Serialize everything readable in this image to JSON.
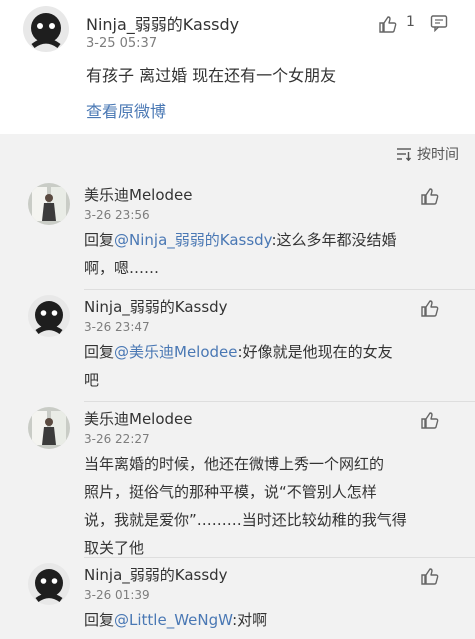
{
  "post": {
    "user": "Ninja_弱弱的Kassdy",
    "time": "3-25 05:37",
    "like_count": "1",
    "content": "有孩子 离过婚 现在还有一个女朋友",
    "view_original": "查看原微博"
  },
  "sort": {
    "label": "按时间"
  },
  "comments": [
    {
      "user": "美乐迪Melodee",
      "time": "3-26 23:56",
      "prefix": "回复",
      "mention": "@Ninja_弱弱的Kassdy",
      "text_line1": ":这么多年都没结婚",
      "text_line2": "啊，嗯……"
    },
    {
      "user": "Ninja_弱弱的Kassdy",
      "time": "3-26 23:47",
      "prefix": "回复",
      "mention": "@美乐迪Melodee",
      "text_line1": ":好像就是他现在的女友",
      "text_line2": "吧"
    },
    {
      "user": "美乐迪Melodee",
      "time": "3-26 22:27",
      "line1": "当年离婚的时候，他还在微博上秀一个网红的",
      "line2": "照片，挺俗气的那种平模，说“不管别人怎样",
      "line3": "说，我就是爱你”………当时还比较幼稚的我气得",
      "line4": "取关了他"
    },
    {
      "user": "Ninja_弱弱的Kassdy",
      "time": "3-26 01:39",
      "prefix": "回复",
      "mention": "@Little_WeNgW",
      "text_line1": ":对啊"
    }
  ],
  "colors": {
    "link": "#4a78b4",
    "panel_bg": "#f2f2f2",
    "post_bg": "#ffffff"
  }
}
